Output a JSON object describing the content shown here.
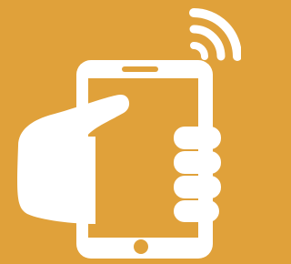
{
  "icon": {
    "name": "hand-holding-phone-with-signal-icon",
    "parts": [
      "phone-icon",
      "hand-icon",
      "wireless-signal-icon",
      "home-button-icon"
    ]
  },
  "colors": {
    "background": "#E0A13A",
    "foreground": "#FFFFFF"
  }
}
